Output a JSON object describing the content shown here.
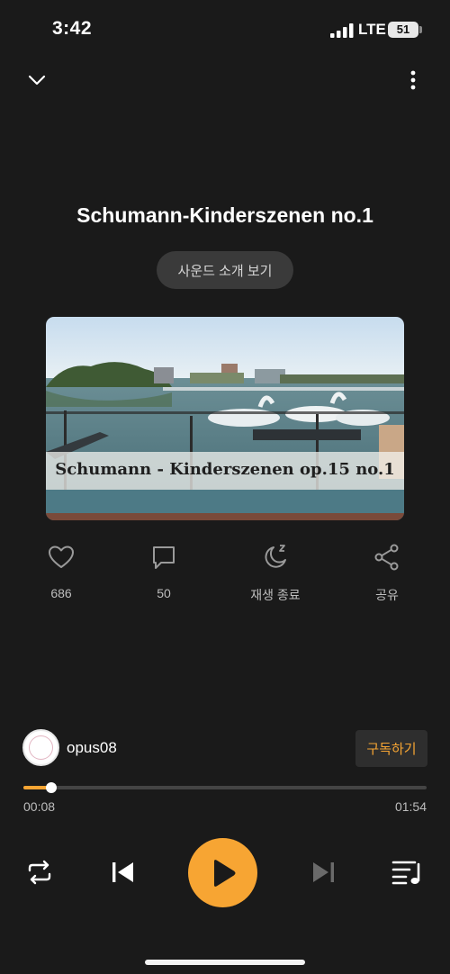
{
  "status_bar": {
    "time": "3:42",
    "network": "LTE",
    "battery": "51"
  },
  "track": {
    "title": "Schumann-Kinderszenen no.1",
    "intro_label": "사운드 소개 보기",
    "artwork_caption": "Schumann - Kinderszenen op.15 no.1"
  },
  "actions": {
    "like": {
      "label": "686",
      "icon": "heart-icon"
    },
    "comment": {
      "label": "50",
      "icon": "comment-icon"
    },
    "sleep": {
      "label": "재생 종료",
      "icon": "moon-icon"
    },
    "share": {
      "label": "공유",
      "icon": "share-icon"
    }
  },
  "channel": {
    "name": "opus08",
    "subscribe_label": "구독하기"
  },
  "player": {
    "elapsed": "00:08",
    "total": "01:54",
    "progress_fraction": 0.07
  },
  "colors": {
    "accent": "#f7a533",
    "background": "#1a1a1a"
  }
}
